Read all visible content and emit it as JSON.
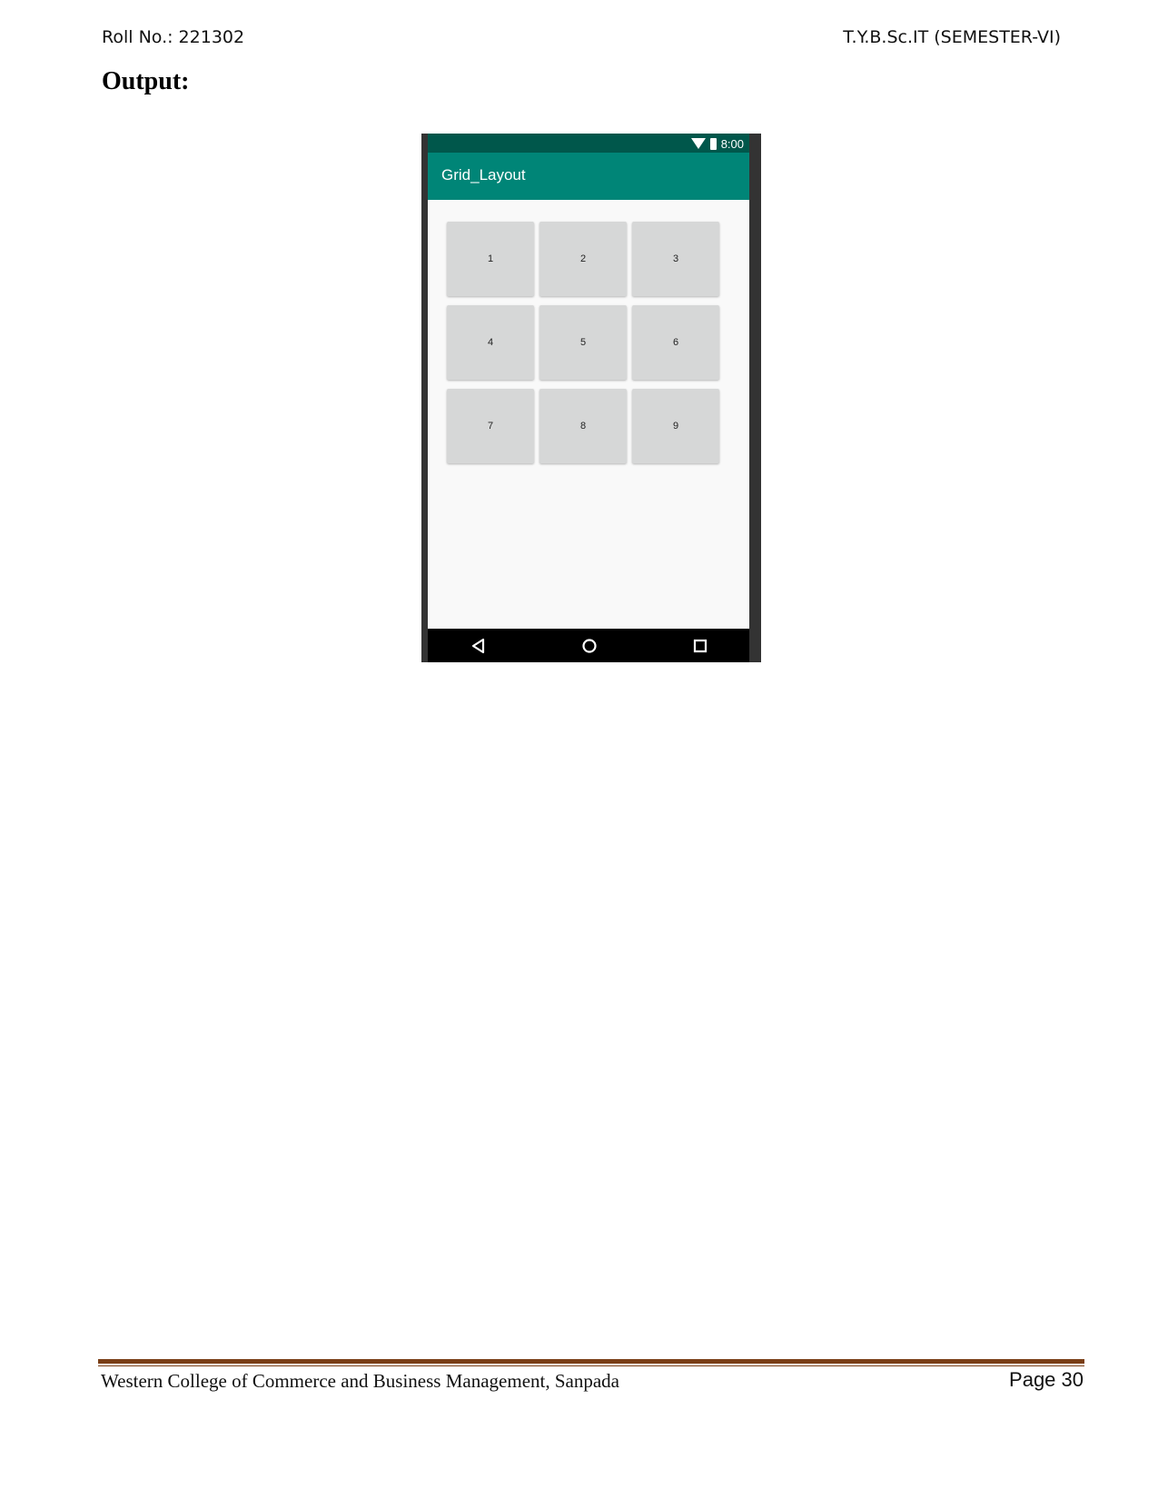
{
  "header": {
    "roll_no": "Roll No.: 221302",
    "course": "T.Y.B.Sc.IT (SEMESTER-VI)"
  },
  "section_heading": "Output:",
  "phone": {
    "status_bar": {
      "time": "8:00",
      "color": "#00574b"
    },
    "app_bar": {
      "title": "Grid_Layout",
      "color": "#008577"
    },
    "grid_buttons": [
      "1",
      "2",
      "3",
      "4",
      "5",
      "6",
      "7",
      "8",
      "9"
    ],
    "nav_icons": [
      "back-icon",
      "home-icon",
      "recent-apps-icon"
    ]
  },
  "footer": {
    "college": "Western College of Commerce and Business Management, Sanpada",
    "page": "Page 30",
    "rule_color": "#7a3e16"
  }
}
